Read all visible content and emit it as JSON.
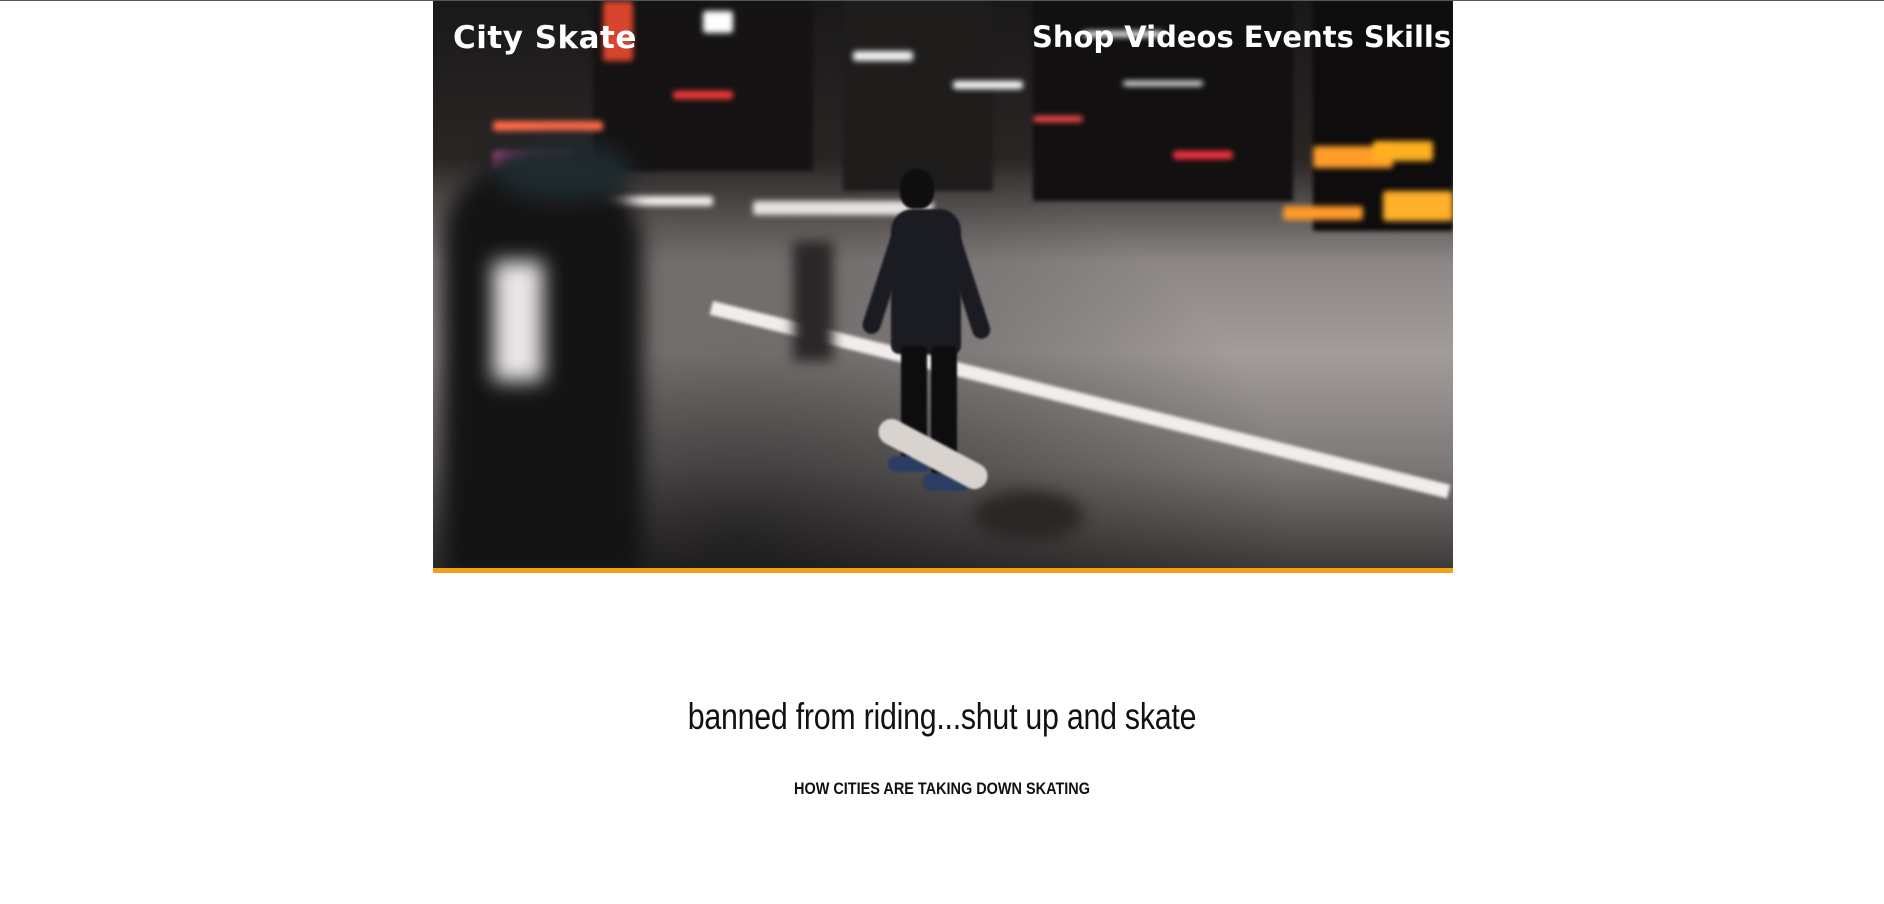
{
  "header": {
    "brand": "City Skate",
    "nav": [
      "Shop",
      "Videos",
      "Events",
      "Skills"
    ]
  },
  "hero": {
    "image_icon": "street-skater-night-photo",
    "accent_color": "#f2a016"
  },
  "article": {
    "headline": "banned from riding...shut up and skate",
    "subheading": "HOW CITIES ARE TAKING DOWN SKATING"
  }
}
